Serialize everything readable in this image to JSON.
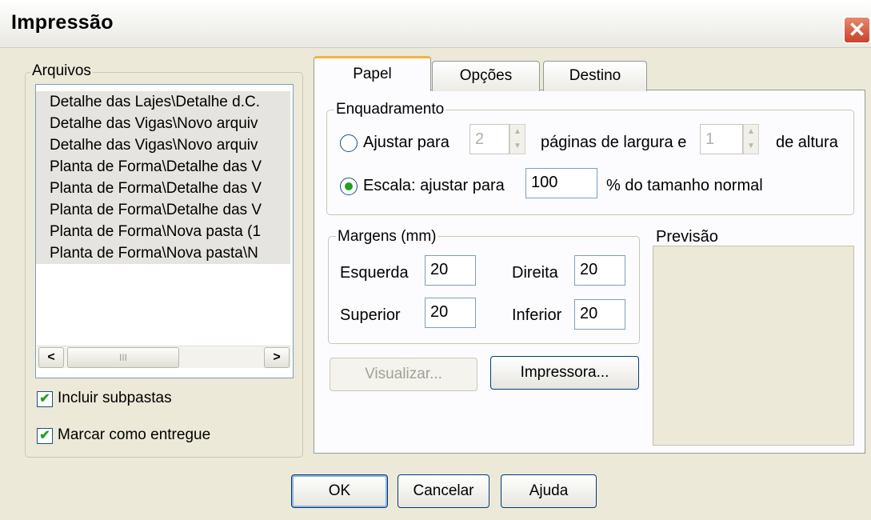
{
  "window": {
    "title": "Impressão",
    "close_symbol": "✕"
  },
  "files": {
    "group_label": "Arquivos",
    "items": [
      "Detalhe das Lajes\\Detalhe d.C.",
      "Detalhe das Vigas\\Novo arquiv",
      "Detalhe das Vigas\\Novo arquiv",
      "Planta de Forma\\Detalhe das V",
      "Planta de Forma\\Detalhe das V",
      "Planta de Forma\\Detalhe das V",
      "Planta de Forma\\Nova pasta (1",
      "Planta de Forma\\Nova pasta\\N"
    ],
    "scroll_left": "<",
    "scroll_right": ">",
    "scroll_thumb_grip": "III",
    "include_subfolders": {
      "label": "Incluir subpastas",
      "checked": true
    },
    "mark_delivered": {
      "label": "Marcar como entregue",
      "checked": true
    },
    "check_mark": "✔"
  },
  "tabs": [
    {
      "label": "Papel",
      "active": true
    },
    {
      "label": "Opções",
      "active": false
    },
    {
      "label": "Destino",
      "active": false
    }
  ],
  "framing": {
    "group_label": "Enquadramento",
    "fit_option": {
      "label": "Ajustar para",
      "selected": false,
      "pages_wide": "2",
      "pages_wide_label": "páginas de largura e",
      "pages_tall": "1",
      "pages_tall_label": "de altura"
    },
    "scale_option": {
      "label": "Escala: ajustar para",
      "selected": true,
      "value": "100",
      "suffix": "% do tamanho normal"
    },
    "spin_up": "▲",
    "spin_down": "▼"
  },
  "margins": {
    "group_label": "Margens (mm)",
    "left_label": "Esquerda",
    "left": "20",
    "right_label": "Direita",
    "right": "20",
    "top_label": "Superior",
    "top": "20",
    "bottom_label": "Inferior",
    "bottom": "20"
  },
  "preview_label": "Previsão",
  "buttons": {
    "preview": "Visualizar...",
    "printer": "Impressora...",
    "ok": "OK",
    "cancel": "Cancelar",
    "help": "Ajuda"
  }
}
